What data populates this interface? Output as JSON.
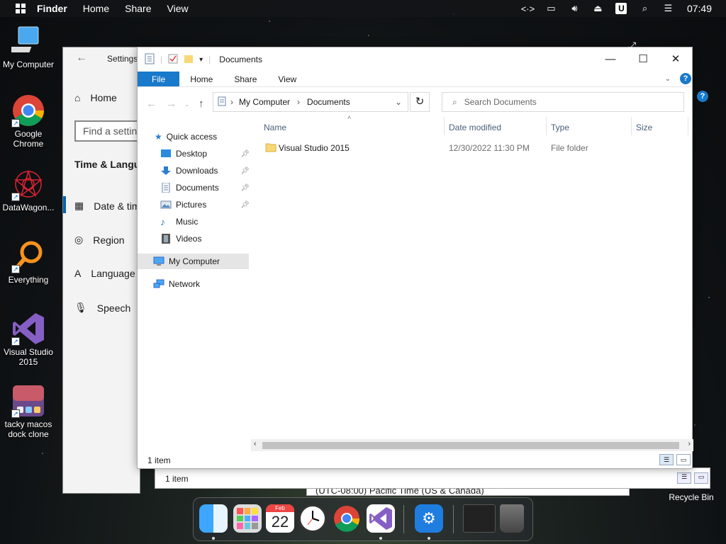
{
  "topbar": {
    "menus": [
      "Finder",
      "Home",
      "Share",
      "View"
    ],
    "clock": "07:49",
    "u_badge": "U"
  },
  "desktop": {
    "icons": [
      {
        "label": "My Computer",
        "icon": "monitor-icon"
      },
      {
        "label": "Google Chrome",
        "icon": "chrome-icon"
      },
      {
        "label": "DataWagon...",
        "icon": "datawagon-icon"
      },
      {
        "label": "Everything",
        "icon": "everything-search-icon"
      },
      {
        "label": "Visual Studio 2015",
        "icon": "visual-studio-icon"
      },
      {
        "label": "tacky macos dock clone",
        "icon": "dock-clone-icon"
      }
    ],
    "recycle_bin": "Recycle Bin"
  },
  "settings": {
    "title": "Settings",
    "home": "Home",
    "search_placeholder": "Find a setting",
    "heading": "Time & Language",
    "items": [
      "Date & time",
      "Region",
      "Language",
      "Speech"
    ],
    "timezone_value": "(UTC-08:00) Pacific Time (US & Canada)"
  },
  "explorer": {
    "title": "Documents",
    "ribbon_tabs": [
      "File",
      "Home",
      "Share",
      "View"
    ],
    "breadcrumb": [
      "My Computer",
      "Documents"
    ],
    "search_placeholder": "Search Documents",
    "columns": [
      "Name",
      "Date modified",
      "Type",
      "Size"
    ],
    "nav": {
      "quick_access": "Quick access",
      "items": [
        "Desktop",
        "Downloads",
        "Documents",
        "Pictures",
        "Music",
        "Videos"
      ],
      "my_computer": "My Computer",
      "network": "Network"
    },
    "rows": [
      {
        "name": "Visual Studio 2015",
        "date": "12/30/2022 11:30 PM",
        "type": "File folder",
        "size": ""
      }
    ],
    "status": "1 item"
  },
  "explorer_back": {
    "status": "1 item"
  },
  "dock": {
    "calendar_month": "Feb",
    "calendar_day": "22"
  },
  "colors": {
    "accent": "#1979ca",
    "folder": "#f8d775"
  }
}
